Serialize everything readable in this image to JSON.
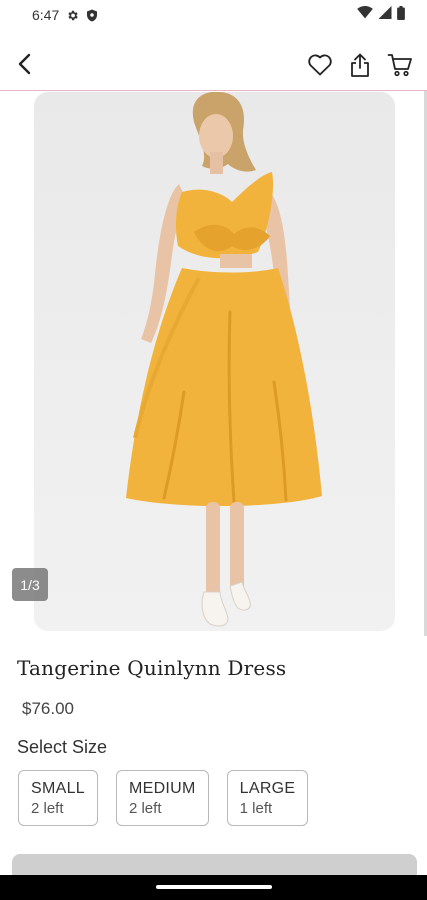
{
  "status_bar": {
    "time": "6:47",
    "left_icons": [
      "gear-icon",
      "shield-icon"
    ],
    "right_icons": [
      "wifi-icon",
      "signal-icon",
      "battery-icon"
    ]
  },
  "header": {
    "back_icon": "chevron-left-icon",
    "actions": [
      "heart-icon",
      "share-icon",
      "cart-icon"
    ]
  },
  "product": {
    "image_alt": "Yellow one-shoulder bow midi dress",
    "image_counter": "1/3",
    "title": "Tangerine Quinlynn Dress",
    "price": "$76.00"
  },
  "size_section": {
    "label": "Select Size",
    "options": [
      {
        "name": "SMALL",
        "stock": "2 left"
      },
      {
        "name": "MEDIUM",
        "stock": "2 left"
      },
      {
        "name": "LARGE",
        "stock": "1 left"
      }
    ]
  },
  "colors": {
    "accent_divider": "#e8b7c1",
    "dress": "#f2b33d",
    "button_disabled": "#cfcfcf"
  }
}
